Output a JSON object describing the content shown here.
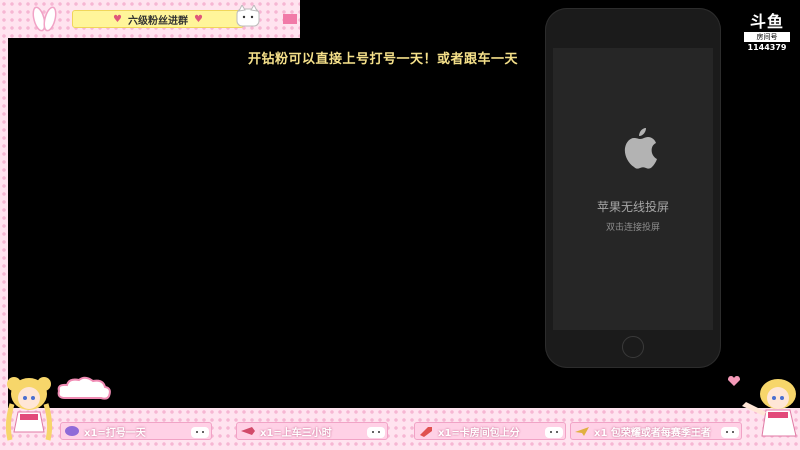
{
  "top_banner": {
    "text": "六级粉丝进群"
  },
  "stream": {
    "title": "开钻粉可以直接上号打号一天！或者跟车一天"
  },
  "phone": {
    "screen_title": "苹果无线投屏",
    "screen_subtitle": "双击连接投屏"
  },
  "douyu": {
    "logo_text": "斗鱼",
    "room_label": "房间号",
    "room_id": "1144379"
  },
  "bottom_panels": [
    {
      "label": "x1=打号一天",
      "icon": "chat-bubble-icon"
    },
    {
      "label": "x1=上车三小时",
      "icon": "rocket-icon"
    },
    {
      "label": "x1=卡房间包上分",
      "icon": "super-rocket-icon"
    },
    {
      "label": "x1 包荣耀或者每赛季王者",
      "icon": "plane-icon"
    }
  ],
  "colors": {
    "frame_pink": "#ffe3ef",
    "dot_pink": "#f6b6d3",
    "banner_yellow": "#fff59a",
    "title_yellow": "#f5e08a",
    "panel_pink": "#ffd1e6"
  }
}
